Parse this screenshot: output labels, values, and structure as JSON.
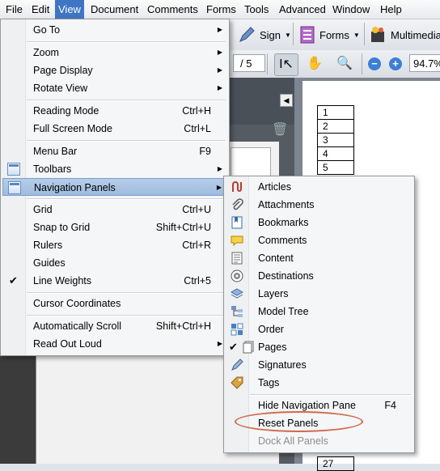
{
  "menubar": {
    "items": [
      "File",
      "Edit",
      "View",
      "Document",
      "Comments",
      "Forms",
      "Tools",
      "Advanced",
      "Window",
      "Help"
    ],
    "active": "View"
  },
  "toolbar": {
    "sign_label": "Sign",
    "forms_label": "Forms",
    "multimedia_label": "Multimedia",
    "page_total": "/ 5",
    "zoom_value": "94.7%"
  },
  "document": {
    "rows": [
      "1",
      "2",
      "3",
      "4",
      "5",
      "27"
    ]
  },
  "view_menu": {
    "items": [
      {
        "label": "Go To",
        "shortcut": "",
        "submenu": true
      },
      {
        "label": "Zoom",
        "shortcut": "",
        "submenu": true
      },
      {
        "label": "Page Display",
        "shortcut": "",
        "submenu": true
      },
      {
        "label": "Rotate View",
        "shortcut": "",
        "submenu": true
      },
      {
        "label": "Reading Mode",
        "shortcut": "Ctrl+H",
        "submenu": false
      },
      {
        "label": "Full Screen Mode",
        "shortcut": "Ctrl+L",
        "submenu": false
      },
      {
        "label": "Menu Bar",
        "shortcut": "F9",
        "submenu": false
      },
      {
        "label": "Toolbars",
        "shortcut": "",
        "submenu": true
      },
      {
        "label": "Navigation Panels",
        "shortcut": "",
        "submenu": true
      },
      {
        "label": "Grid",
        "shortcut": "Ctrl+U",
        "submenu": false
      },
      {
        "label": "Snap to Grid",
        "shortcut": "Shift+Ctrl+U",
        "submenu": false
      },
      {
        "label": "Rulers",
        "shortcut": "Ctrl+R",
        "submenu": false
      },
      {
        "label": "Guides",
        "shortcut": "",
        "submenu": false
      },
      {
        "label": "Line Weights",
        "shortcut": "Ctrl+5",
        "submenu": false
      },
      {
        "label": "Cursor Coordinates",
        "shortcut": "",
        "submenu": false
      },
      {
        "label": "Automatically Scroll",
        "shortcut": "Shift+Ctrl+H",
        "submenu": false
      },
      {
        "label": "Read Out Loud",
        "shortcut": "",
        "submenu": true
      }
    ],
    "highlighted": "Navigation Panels",
    "checked": "Line Weights"
  },
  "nav_submenu": {
    "items": [
      {
        "label": "Articles",
        "icon": "articles-icon"
      },
      {
        "label": "Attachments",
        "icon": "paperclip-icon"
      },
      {
        "label": "Bookmarks",
        "icon": "bookmark-icon"
      },
      {
        "label": "Comments",
        "icon": "speech-bubble-icon"
      },
      {
        "label": "Content",
        "icon": "content-icon"
      },
      {
        "label": "Destinations",
        "icon": "target-icon"
      },
      {
        "label": "Layers",
        "icon": "layers-icon"
      },
      {
        "label": "Model Tree",
        "icon": "tree-icon"
      },
      {
        "label": "Order",
        "icon": "order-icon"
      },
      {
        "label": "Pages",
        "icon": "pages-icon"
      },
      {
        "label": "Signatures",
        "icon": "pen-icon"
      },
      {
        "label": "Tags",
        "icon": "tag-icon"
      }
    ],
    "checked": "Pages",
    "hide_label": "Hide Navigation Pane",
    "hide_shortcut": "F4",
    "reset_label": "Reset Panels",
    "dock_label": "Dock All Panels"
  }
}
